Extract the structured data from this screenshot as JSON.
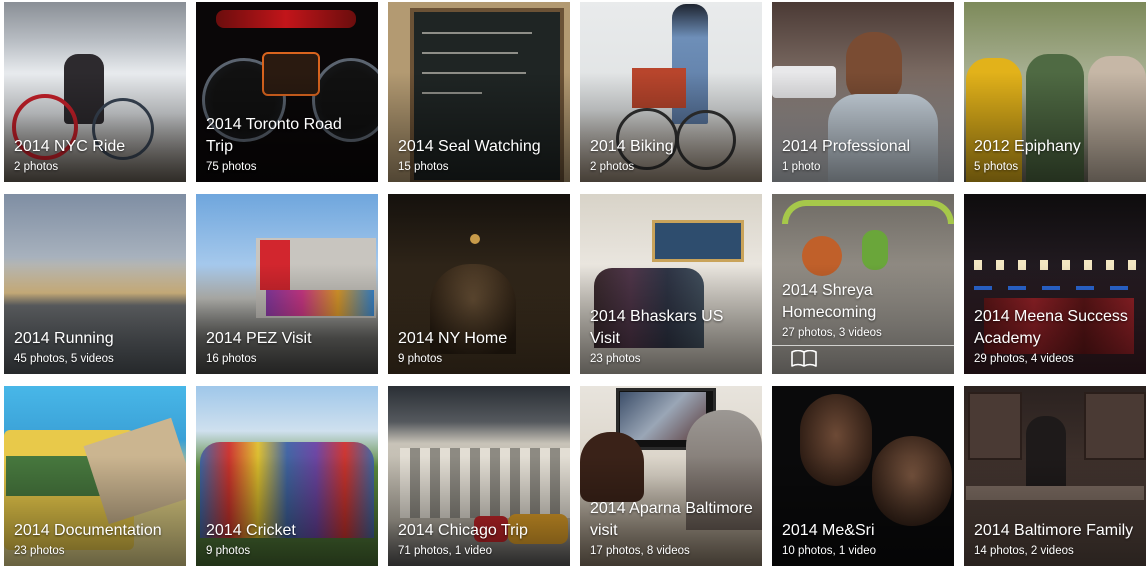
{
  "albums": [
    {
      "title": "2014 NYC Ride",
      "count": "2 photos"
    },
    {
      "title": "2014 Toronto Road Trip",
      "count": "75 photos"
    },
    {
      "title": "2014 Seal Watching",
      "count": "15 photos"
    },
    {
      "title": "2014 Biking",
      "count": "2 photos"
    },
    {
      "title": "2014 Professional",
      "count": "1 photo"
    },
    {
      "title": "2012 Epiphany",
      "count": "5 photos"
    },
    {
      "title": "2014 Running",
      "count": "45 photos, 5 videos"
    },
    {
      "title": "2014 PEZ Visit",
      "count": "16 photos"
    },
    {
      "title": "2014 NY Home",
      "count": "9 photos"
    },
    {
      "title": "2014 Bhaskars US Visit",
      "count": "23 photos"
    },
    {
      "title": "2014 Shreya Homecoming",
      "count": "27 photos, 3 videos"
    },
    {
      "title": "2014 Meena Success Academy",
      "count": "29 photos, 4 videos"
    },
    {
      "title": "2014 Documentation",
      "count": "23 photos"
    },
    {
      "title": "2014 Cricket",
      "count": "9 photos"
    },
    {
      "title": "2014 Chicago Trip",
      "count": "71 photos, 1 video"
    },
    {
      "title": "2014 Aparna Baltimore visit",
      "count": "17 photos, 8 videos"
    },
    {
      "title": "2014 Me&Sri",
      "count": "10 photos, 1 video"
    },
    {
      "title": "2014 Baltimore Family",
      "count": "14 photos, 2 videos"
    }
  ],
  "icons": {
    "story": "book-open-icon"
  }
}
